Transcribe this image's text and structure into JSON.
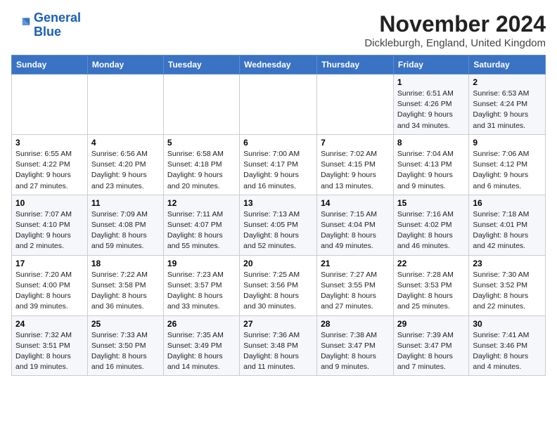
{
  "logo": {
    "line1": "General",
    "line2": "Blue"
  },
  "title": "November 2024",
  "location": "Dickleburgh, England, United Kingdom",
  "days_of_week": [
    "Sunday",
    "Monday",
    "Tuesday",
    "Wednesday",
    "Thursday",
    "Friday",
    "Saturday"
  ],
  "weeks": [
    [
      {
        "day": "",
        "info": ""
      },
      {
        "day": "",
        "info": ""
      },
      {
        "day": "",
        "info": ""
      },
      {
        "day": "",
        "info": ""
      },
      {
        "day": "",
        "info": ""
      },
      {
        "day": "1",
        "info": "Sunrise: 6:51 AM\nSunset: 4:26 PM\nDaylight: 9 hours and 34 minutes."
      },
      {
        "day": "2",
        "info": "Sunrise: 6:53 AM\nSunset: 4:24 PM\nDaylight: 9 hours and 31 minutes."
      }
    ],
    [
      {
        "day": "3",
        "info": "Sunrise: 6:55 AM\nSunset: 4:22 PM\nDaylight: 9 hours and 27 minutes."
      },
      {
        "day": "4",
        "info": "Sunrise: 6:56 AM\nSunset: 4:20 PM\nDaylight: 9 hours and 23 minutes."
      },
      {
        "day": "5",
        "info": "Sunrise: 6:58 AM\nSunset: 4:18 PM\nDaylight: 9 hours and 20 minutes."
      },
      {
        "day": "6",
        "info": "Sunrise: 7:00 AM\nSunset: 4:17 PM\nDaylight: 9 hours and 16 minutes."
      },
      {
        "day": "7",
        "info": "Sunrise: 7:02 AM\nSunset: 4:15 PM\nDaylight: 9 hours and 13 minutes."
      },
      {
        "day": "8",
        "info": "Sunrise: 7:04 AM\nSunset: 4:13 PM\nDaylight: 9 hours and 9 minutes."
      },
      {
        "day": "9",
        "info": "Sunrise: 7:06 AM\nSunset: 4:12 PM\nDaylight: 9 hours and 6 minutes."
      }
    ],
    [
      {
        "day": "10",
        "info": "Sunrise: 7:07 AM\nSunset: 4:10 PM\nDaylight: 9 hours and 2 minutes."
      },
      {
        "day": "11",
        "info": "Sunrise: 7:09 AM\nSunset: 4:08 PM\nDaylight: 8 hours and 59 minutes."
      },
      {
        "day": "12",
        "info": "Sunrise: 7:11 AM\nSunset: 4:07 PM\nDaylight: 8 hours and 55 minutes."
      },
      {
        "day": "13",
        "info": "Sunrise: 7:13 AM\nSunset: 4:05 PM\nDaylight: 8 hours and 52 minutes."
      },
      {
        "day": "14",
        "info": "Sunrise: 7:15 AM\nSunset: 4:04 PM\nDaylight: 8 hours and 49 minutes."
      },
      {
        "day": "15",
        "info": "Sunrise: 7:16 AM\nSunset: 4:02 PM\nDaylight: 8 hours and 46 minutes."
      },
      {
        "day": "16",
        "info": "Sunrise: 7:18 AM\nSunset: 4:01 PM\nDaylight: 8 hours and 42 minutes."
      }
    ],
    [
      {
        "day": "17",
        "info": "Sunrise: 7:20 AM\nSunset: 4:00 PM\nDaylight: 8 hours and 39 minutes."
      },
      {
        "day": "18",
        "info": "Sunrise: 7:22 AM\nSunset: 3:58 PM\nDaylight: 8 hours and 36 minutes."
      },
      {
        "day": "19",
        "info": "Sunrise: 7:23 AM\nSunset: 3:57 PM\nDaylight: 8 hours and 33 minutes."
      },
      {
        "day": "20",
        "info": "Sunrise: 7:25 AM\nSunset: 3:56 PM\nDaylight: 8 hours and 30 minutes."
      },
      {
        "day": "21",
        "info": "Sunrise: 7:27 AM\nSunset: 3:55 PM\nDaylight: 8 hours and 27 minutes."
      },
      {
        "day": "22",
        "info": "Sunrise: 7:28 AM\nSunset: 3:53 PM\nDaylight: 8 hours and 25 minutes."
      },
      {
        "day": "23",
        "info": "Sunrise: 7:30 AM\nSunset: 3:52 PM\nDaylight: 8 hours and 22 minutes."
      }
    ],
    [
      {
        "day": "24",
        "info": "Sunrise: 7:32 AM\nSunset: 3:51 PM\nDaylight: 8 hours and 19 minutes."
      },
      {
        "day": "25",
        "info": "Sunrise: 7:33 AM\nSunset: 3:50 PM\nDaylight: 8 hours and 16 minutes."
      },
      {
        "day": "26",
        "info": "Sunrise: 7:35 AM\nSunset: 3:49 PM\nDaylight: 8 hours and 14 minutes."
      },
      {
        "day": "27",
        "info": "Sunrise: 7:36 AM\nSunset: 3:48 PM\nDaylight: 8 hours and 11 minutes."
      },
      {
        "day": "28",
        "info": "Sunrise: 7:38 AM\nSunset: 3:47 PM\nDaylight: 8 hours and 9 minutes."
      },
      {
        "day": "29",
        "info": "Sunrise: 7:39 AM\nSunset: 3:47 PM\nDaylight: 8 hours and 7 minutes."
      },
      {
        "day": "30",
        "info": "Sunrise: 7:41 AM\nSunset: 3:46 PM\nDaylight: 8 hours and 4 minutes."
      }
    ]
  ]
}
